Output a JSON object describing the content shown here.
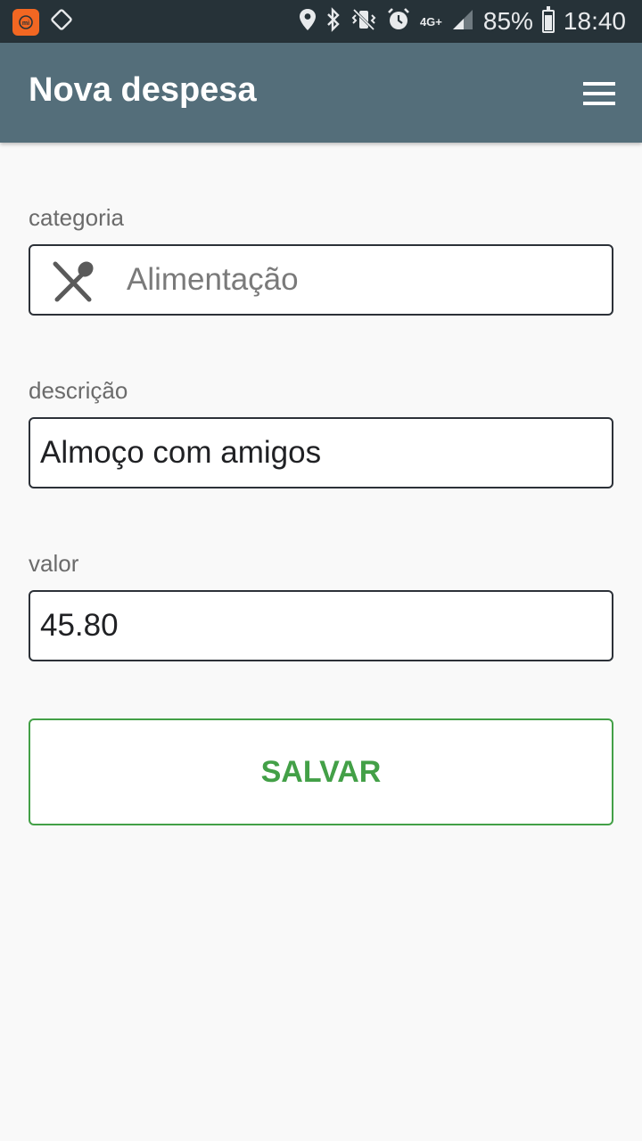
{
  "status_bar": {
    "network": "4G+",
    "battery": "85%",
    "battery_level": 0.85,
    "time": "18:40",
    "icons": [
      "mi-app-icon",
      "screen-rotate-icon",
      "location-icon",
      "bluetooth-icon",
      "vibrate-icon",
      "alarm-icon",
      "signal-icon",
      "battery-icon"
    ]
  },
  "appbar": {
    "title": "Nova despesa",
    "menu_icon": "hamburger-menu-icon"
  },
  "form": {
    "category": {
      "label": "categoria",
      "value": "Alimentação",
      "icon": "fork-spoon-icon"
    },
    "description": {
      "label": "descrição",
      "value": "Almoço com amigos"
    },
    "amount": {
      "label": "valor",
      "value": "45.80"
    },
    "save_label": "SALVAR"
  },
  "colors": {
    "status_bar": "#263238",
    "appbar": "#546e7a",
    "accent_green": "#43a047",
    "background": "#f9f9f9"
  }
}
